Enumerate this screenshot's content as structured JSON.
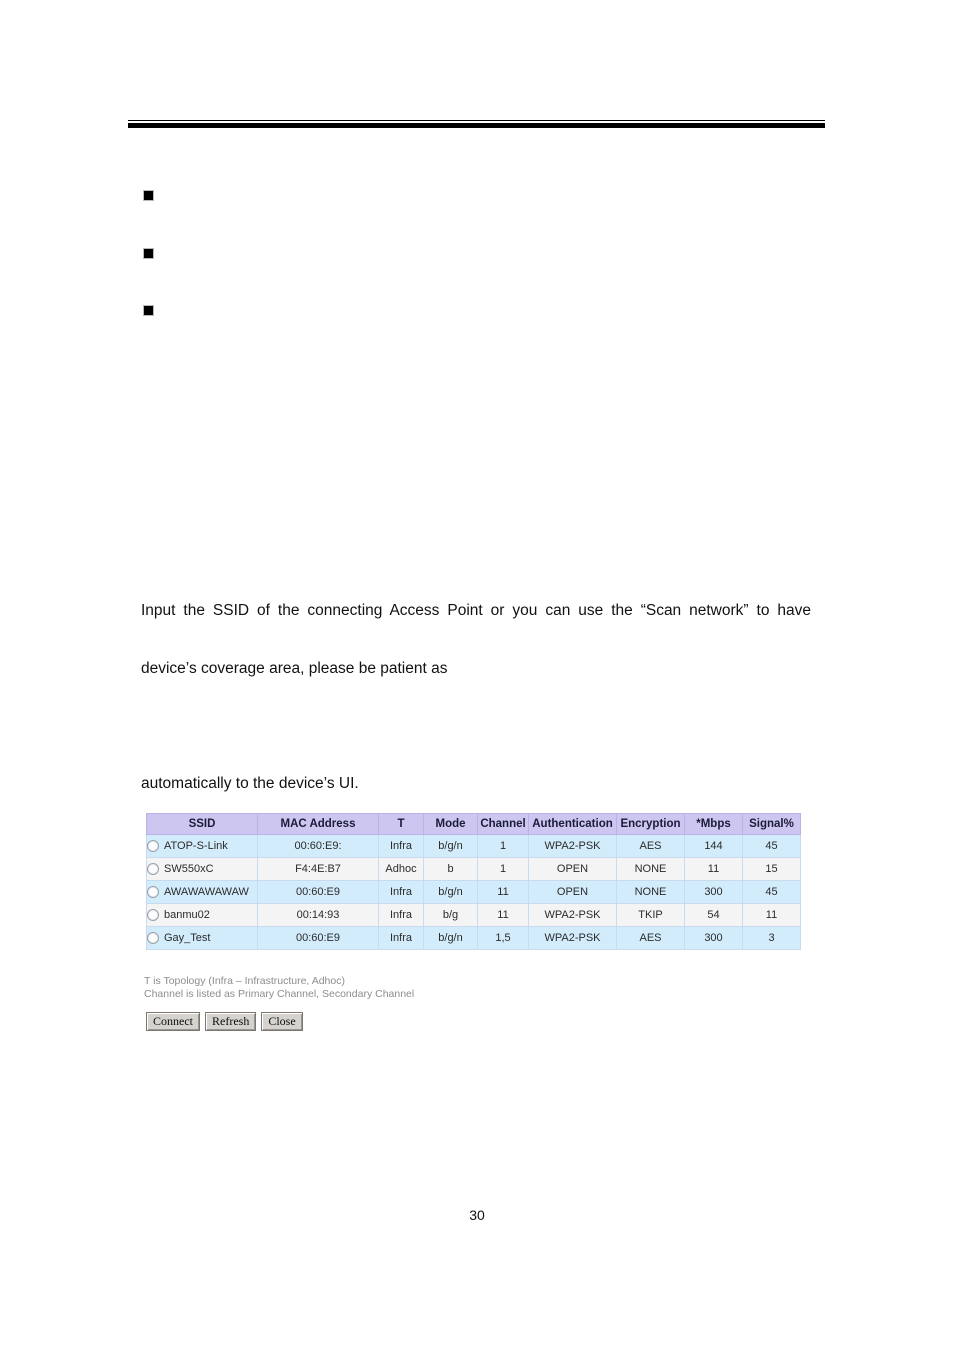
{
  "page": {
    "number": "30"
  },
  "bullets": [
    {
      "name": "bullet-marker-1"
    },
    {
      "name": "bullet-marker-2"
    },
    {
      "name": "bullet-marker-3"
    }
  ],
  "body": {
    "paragraph_1": "Input the SSID of the connecting Access Point or you can use the “Scan network” to have",
    "paragraph_2": "device’s coverage area, please be patient as",
    "paragraph_3": "automatically to the device’s UI."
  },
  "scan_table": {
    "headers": [
      "SSID",
      "MAC Address",
      "T",
      "Mode",
      "Channel",
      "Authentication",
      "Encryption",
      "*Mbps",
      "Signal%"
    ],
    "rows": [
      {
        "selected": false,
        "ssid": "ATOP-S-Link",
        "mac": "00:60:E9:",
        "mac_align": "left",
        "t": "Infra",
        "mode": "b/g/n",
        "channel": "1",
        "authentication": "WPA2-PSK",
        "encryption": "AES",
        "mbps": "144",
        "signal": "45"
      },
      {
        "selected": false,
        "ssid": "SW550xC",
        "mac": "F4:4E:B7",
        "mac_align": "right",
        "t": "Adhoc",
        "mode": "b",
        "channel": "1",
        "authentication": "OPEN",
        "encryption": "NONE",
        "mbps": "11",
        "signal": "15"
      },
      {
        "selected": false,
        "ssid": "AWAWAWAWAW",
        "mac": "00:60:E9",
        "mac_align": "left",
        "t": "Infra",
        "mode": "b/g/n",
        "channel": "11",
        "authentication": "OPEN",
        "encryption": "NONE",
        "mbps": "300",
        "signal": "45"
      },
      {
        "selected": false,
        "ssid": "banmu02",
        "mac": "00:14:93",
        "mac_align": "right",
        "t": "Infra",
        "mode": "b/g",
        "channel": "11",
        "authentication": "WPA2-PSK",
        "encryption": "TKIP",
        "mbps": "54",
        "signal": "11"
      },
      {
        "selected": false,
        "ssid": "Gay_Test",
        "mac": "00:60:E9",
        "mac_align": "left",
        "t": "Infra",
        "mode": "b/g/n",
        "channel": "1,5",
        "authentication": "WPA2-PSK",
        "encryption": "AES",
        "mbps": "300",
        "signal": "3"
      }
    ],
    "footnotes": [
      "T is Topology (Infra – Infrastructure, Adhoc)",
      "Channel is listed as Primary Channel, Secondary Channel"
    ],
    "buttons": [
      {
        "name": "connect-button",
        "label": "Connect"
      },
      {
        "name": "refresh-button",
        "label": "Refresh"
      },
      {
        "name": "close-button",
        "label": "Close"
      }
    ]
  },
  "colors": {
    "header_background": "#ccc6f0",
    "row_odd_background": "#d3ecfb",
    "row_even_background": "#f4f4f4",
    "cell_border": "#c9d9ee",
    "footnote_text": "#8d8d8d",
    "button_face": "#d6d3ce",
    "rule": "#000000"
  }
}
